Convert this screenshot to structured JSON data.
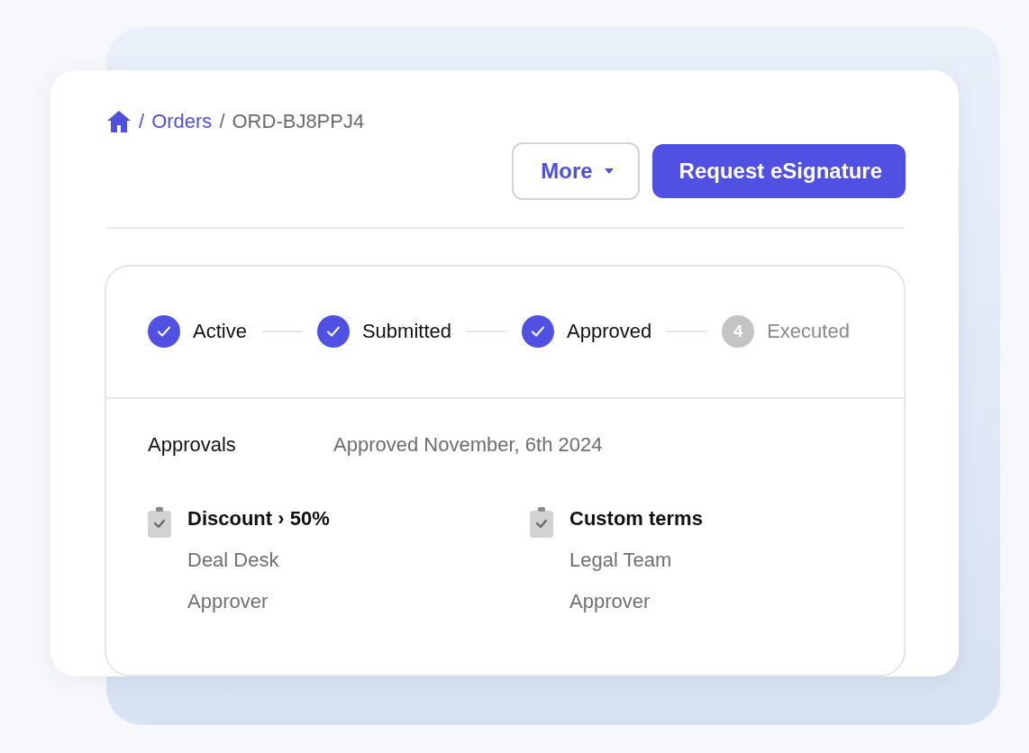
{
  "breadcrumb": {
    "separator": "/",
    "items": [
      {
        "label": "Orders",
        "link": true
      },
      {
        "label": "ORD-BJ8PPJ4",
        "link": false
      }
    ]
  },
  "actions": [
    {
      "label": "More",
      "kind": "dropdown"
    },
    {
      "label": "Request eSignature",
      "kind": "primary"
    }
  ],
  "steps": [
    {
      "label": "Active",
      "completed": true
    },
    {
      "label": "Submitted",
      "completed": true
    },
    {
      "label": "Approved",
      "completed": true
    },
    {
      "label": "Executed",
      "completed": false,
      "number": "4"
    }
  ],
  "approvals": {
    "title": "Approvals",
    "status": "Approved November, 6th 2024",
    "items": [
      {
        "name": "Discount › 50%",
        "team": "Deal Desk",
        "role": "Approver"
      },
      {
        "name": "Custom terms",
        "team": "Legal Team",
        "role": "Approver"
      }
    ]
  }
}
